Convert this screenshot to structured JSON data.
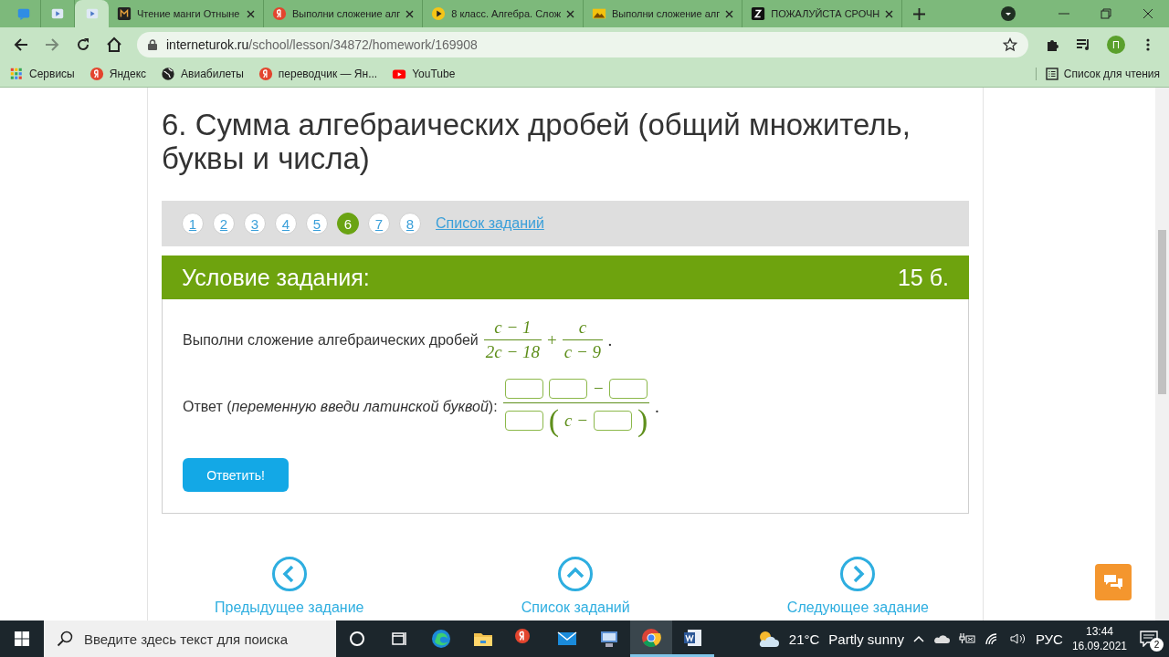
{
  "browser": {
    "tabs": [
      {
        "kind": "chat",
        "selected": false
      },
      {
        "kind": "video",
        "selected": false
      },
      {
        "kind": "video",
        "selected": true
      },
      {
        "kind": "manga",
        "title": "Чтение манги Отныне",
        "selected": false
      },
      {
        "kind": "yandex",
        "title": "Выполни сложение алг",
        "selected": false
      },
      {
        "kind": "play",
        "title": "8 класс. Алгебра. Слож",
        "selected": false
      },
      {
        "kind": "image",
        "title": "Выполни сложение алг",
        "selected": false
      },
      {
        "kind": "z",
        "title": "ПОЖАЛУЙСТА СРОЧН",
        "selected": false
      }
    ],
    "address": {
      "host": "interneturok.ru",
      "path": "/school/lesson/34872/homework/169908"
    },
    "profile": "П",
    "bookmarks": [
      {
        "kind": "apps",
        "label": "Сервисы"
      },
      {
        "kind": "yandex",
        "label": "Яндекс"
      },
      {
        "kind": "globe",
        "label": "Авиабилеты"
      },
      {
        "kind": "yandex",
        "label": "переводчик — Ян..."
      },
      {
        "kind": "youtube",
        "label": "YouTube"
      }
    ],
    "reading_list": "Список для чтения"
  },
  "page": {
    "title": "6. Сумма алгебраических дробей (общий множитель, буквы и числа)",
    "pagination": [
      {
        "label": "1",
        "selected": false
      },
      {
        "label": "2",
        "selected": false
      },
      {
        "label": "3",
        "selected": false
      },
      {
        "label": "4",
        "selected": false
      },
      {
        "label": "5",
        "selected": false
      },
      {
        "label": "6",
        "selected": true
      },
      {
        "label": "7",
        "selected": false
      },
      {
        "label": "8",
        "selected": false
      }
    ],
    "task_list_link": "Список заданий",
    "task_header": {
      "title": "Условие задания:",
      "points": "15 б."
    },
    "task": {
      "text": "Выполни сложение алгебраических дробей",
      "fractions": [
        {
          "numerator": "c − 1",
          "denominator": "2c − 18"
        },
        {
          "numerator": "c",
          "denominator": "c − 9"
        }
      ],
      "operator": "+",
      "end": "."
    },
    "answer": {
      "label": "Ответ (*переменную введи латинской буквой*):",
      "numerator": [
        {
          "kind": "box"
        },
        {
          "kind": "box"
        },
        {
          "kind": "text",
          "text": "−"
        },
        {
          "kind": "box"
        }
      ],
      "denominator": [
        {
          "kind": "box"
        },
        {
          "kind": "paren",
          "text": "("
        },
        {
          "kind": "text",
          "text": "c −"
        },
        {
          "kind": "box"
        },
        {
          "kind": "paren",
          "text": ")"
        }
      ],
      "end": "."
    },
    "submit": "Ответить!",
    "nav": [
      {
        "kind": "left",
        "label": "Предыдущее задание"
      },
      {
        "kind": "up",
        "label": "Список заданий"
      },
      {
        "kind": "right",
        "label": "Следующее задание"
      }
    ]
  },
  "taskbar": {
    "search_placeholder": "Введите здесь текст для поиска",
    "apps": [
      {
        "kind": "cortana",
        "selected": false,
        "running": false
      },
      {
        "kind": "taskview",
        "selected": false,
        "running": false
      },
      {
        "kind": "edge",
        "selected": false,
        "running": false
      },
      {
        "kind": "folder",
        "selected": false,
        "running": false
      },
      {
        "kind": "yandex",
        "selected": false,
        "running": false
      },
      {
        "kind": "mail",
        "selected": false,
        "running": false
      },
      {
        "kind": "computer",
        "selected": false,
        "running": false
      },
      {
        "kind": "chrome",
        "selected": true,
        "running": true
      },
      {
        "kind": "word",
        "selected": false,
        "running": true
      }
    ],
    "temperature": "21°C",
    "weather": "Partly sunny",
    "language": "РУС",
    "time": "13:44",
    "date": "16.09.2021",
    "notifications": "2"
  }
}
